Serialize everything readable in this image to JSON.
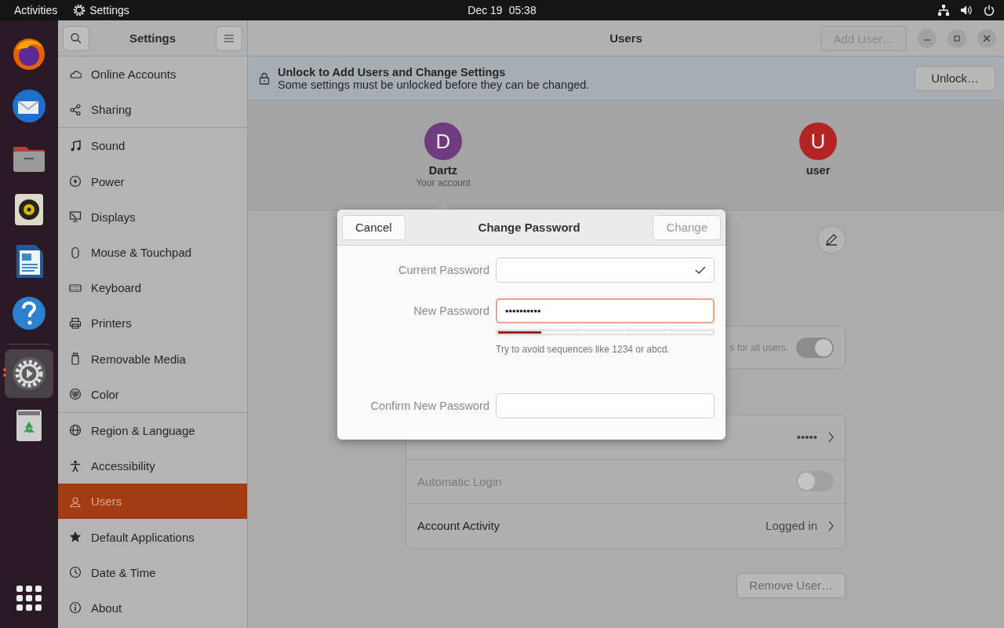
{
  "top_bar": {
    "activities": "Activities",
    "app_name": "Settings",
    "date": "Dec 19",
    "time": "05:38"
  },
  "dock": {
    "apps": [
      {
        "running": false,
        "selected": false
      },
      {
        "running": false,
        "selected": false
      },
      {
        "running": false,
        "selected": false
      },
      {
        "running": false,
        "selected": false
      },
      {
        "running": false,
        "selected": false
      },
      {
        "running": false,
        "selected": false
      },
      {
        "running": true,
        "selected": true
      },
      {
        "running": false,
        "selected": false
      }
    ]
  },
  "sidebar": {
    "title": "Settings",
    "groups": [
      [
        {
          "label": "Online Accounts",
          "selected": false
        },
        {
          "label": "Sharing",
          "selected": false
        }
      ],
      [
        {
          "label": "Sound",
          "selected": false
        },
        {
          "label": "Power",
          "selected": false
        },
        {
          "label": "Displays",
          "selected": false
        },
        {
          "label": "Mouse & Touchpad",
          "selected": false
        },
        {
          "label": "Keyboard",
          "selected": false
        },
        {
          "label": "Printers",
          "selected": false
        },
        {
          "label": "Removable Media",
          "selected": false
        },
        {
          "label": "Color",
          "selected": false
        }
      ],
      [
        {
          "label": "Region & Language",
          "selected": false
        },
        {
          "label": "Accessibility",
          "selected": false
        },
        {
          "label": "Users",
          "selected": true
        },
        {
          "label": "Default Applications",
          "selected": false
        },
        {
          "label": "Date & Time",
          "selected": false
        },
        {
          "label": "About",
          "selected": false
        }
      ]
    ]
  },
  "main": {
    "title": "Users",
    "add_user_button": {
      "label": "Add User…",
      "disabled": true
    },
    "unlock_bar": {
      "title": "Unlock to Add Users and Change Settings",
      "message": "Some settings must be unlocked before they can be changed.",
      "button": "Unlock…"
    },
    "users": [
      {
        "initial": "D",
        "name": "Dartz",
        "subtitle": "Your account",
        "color": "#6f3a7e",
        "selected": true
      },
      {
        "initial": "U",
        "name": "user",
        "color": "#b52424",
        "selected": false
      }
    ],
    "admin_card": {
      "text": "s for all users.",
      "on": true
    },
    "settings_rows": [
      {
        "kind": "link",
        "value": "•••••",
        "disabled": false
      },
      {
        "kind": "toggle",
        "label": "Automatic Login",
        "on": false,
        "disabled": true
      },
      {
        "kind": "link",
        "label": "Account Activity",
        "value": "Logged in",
        "disabled": false
      }
    ],
    "remove_button": "Remove User…"
  },
  "dialog": {
    "title": "Change Password",
    "cancel": "Cancel",
    "confirm": {
      "label": "Change",
      "disabled": true
    },
    "fields": [
      {
        "label": "Current Password",
        "valid": true,
        "focused": false
      },
      {
        "label": "New Password",
        "value": "••••••••••",
        "valid": false,
        "focused": true,
        "strength": {
          "level": 0.2
        },
        "hint": "Try to avoid sequences like 1234 or abcd."
      },
      {
        "label": "Confirm New Password",
        "valid": false,
        "focused": false
      }
    ]
  }
}
